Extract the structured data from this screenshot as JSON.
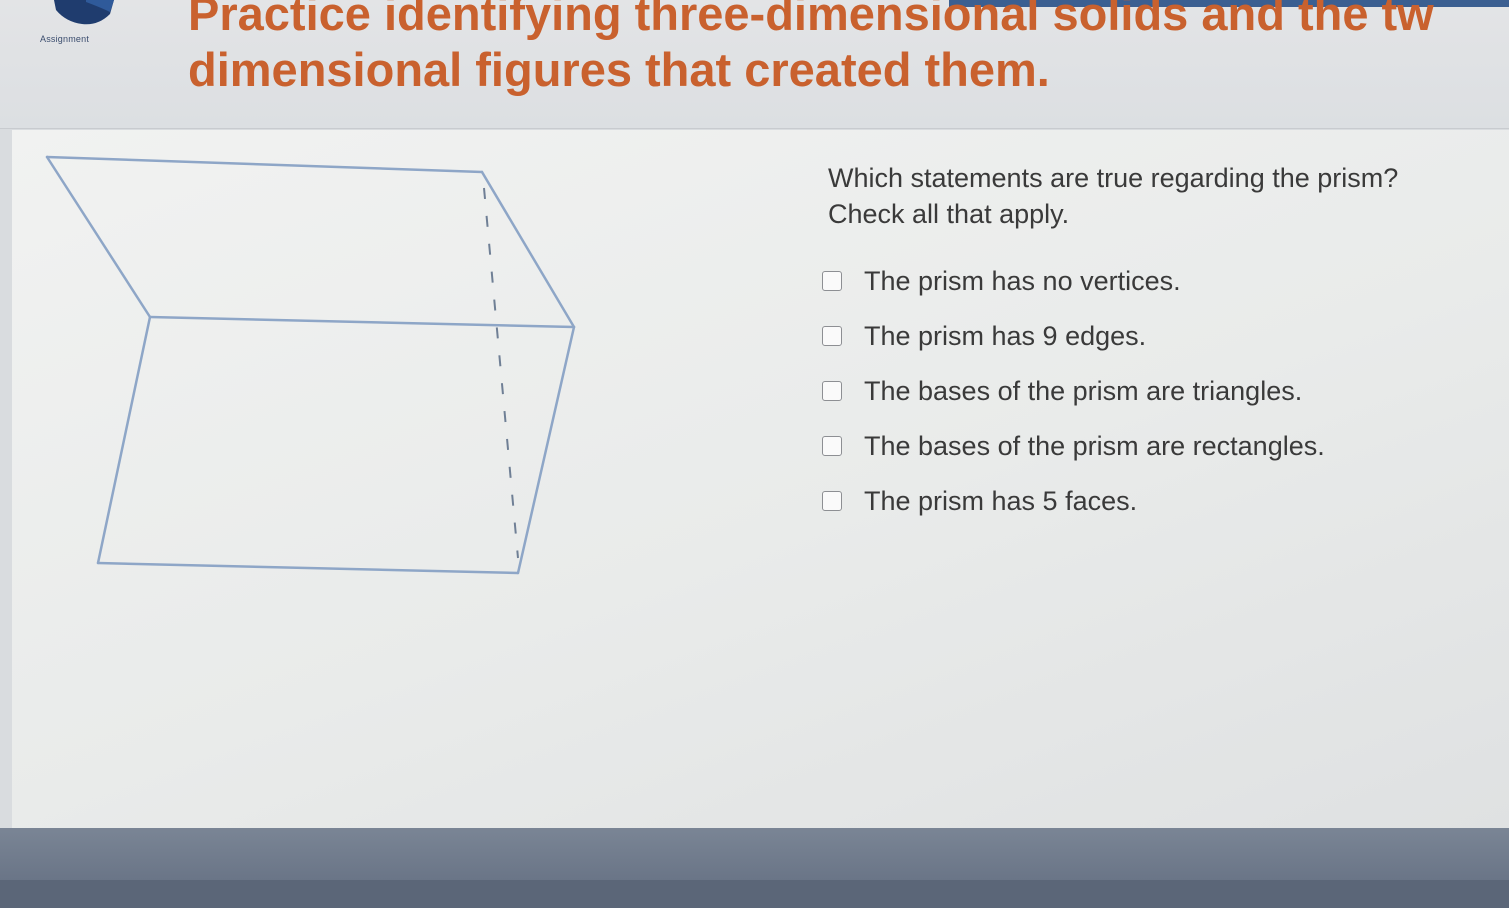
{
  "header": {
    "label": "Assignment",
    "title_line1": "Practice identifying three-dimensional solids and the tw",
    "title_line2": "dimensional figures that created them."
  },
  "question": {
    "prompt": "Which statements are true regarding the prism?",
    "instruction": "Check all that apply."
  },
  "options": [
    {
      "label": "The prism has no vertices.",
      "checked": false
    },
    {
      "label": "The prism has 9 edges.",
      "checked": false
    },
    {
      "label": "The bases of the prism are triangles.",
      "checked": false
    },
    {
      "label": "The bases of the prism are rectangles.",
      "checked": false
    },
    {
      "label": "The prism has 5 faces.",
      "checked": false
    }
  ],
  "colors": {
    "title": "#c9612e",
    "accent": "#3b5f91",
    "figure_lines": "#8ea6c7",
    "text": "#3a3a3a"
  }
}
